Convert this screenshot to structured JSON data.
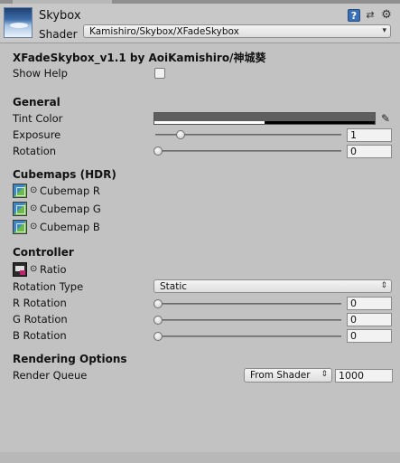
{
  "header": {
    "material_name": "Skybox",
    "shader_label": "Shader",
    "shader_value": "Kamishiro/Skybox/XFadeSkybox",
    "help_icon_glyph": "?",
    "preset_icon_glyph": "⇄",
    "gear_icon_glyph": "⚙"
  },
  "title": "XFadeSkybox_v1.1 by AoiKamishiro/神城葵",
  "show_help": {
    "label": "Show Help",
    "checked": false
  },
  "general": {
    "heading": "General",
    "tint_color_label": "Tint Color",
    "tint_color": "#5e5e5e",
    "exposure": {
      "label": "Exposure",
      "value": "1",
      "slider_fraction": 0.125
    },
    "rotation": {
      "label": "Rotation",
      "value": "0",
      "slider_fraction": 0
    }
  },
  "cubemaps": {
    "heading": "Cubemaps (HDR)",
    "items": [
      {
        "label": "Cubemap R",
        "circle": "⊙"
      },
      {
        "label": "Cubemap G",
        "circle": "⊙"
      },
      {
        "label": "Cubemap B",
        "circle": "⊙"
      }
    ]
  },
  "controller": {
    "heading": "Controller",
    "ratio_label": "Ratio",
    "ratio_circle": "⊙",
    "rotation_type": {
      "label": "Rotation Type",
      "value": "Static"
    },
    "r_rotation": {
      "label": "R Rotation",
      "value": "0"
    },
    "g_rotation": {
      "label": "G Rotation",
      "value": "0"
    },
    "b_rotation": {
      "label": "B Rotation",
      "value": "0"
    }
  },
  "rendering": {
    "heading": "Rendering Options",
    "render_queue": {
      "label": "Render Queue",
      "source": "From Shader",
      "value": "1000"
    }
  },
  "icons": {
    "material_preview": "skybox-material-icon",
    "cubemap": "cubemap-texture-icon",
    "ratio": "render-texture-icon",
    "eyedropper": "eyedropper-icon"
  },
  "colors": {
    "background": "#c2c2c2",
    "help_blue": "#3a6fb5"
  }
}
